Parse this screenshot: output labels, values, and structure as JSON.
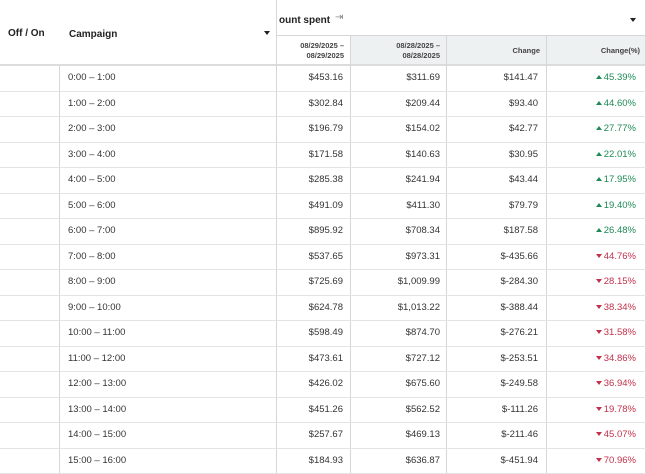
{
  "header": {
    "off_on": "Off / On",
    "campaign": "Campaign",
    "group_label": "ount spent",
    "resize_icon": "⇥",
    "date_range_1": [
      "08/29/2025 –",
      "08/29/2025"
    ],
    "date_range_2": [
      "08/28/2025 –",
      "08/28/2025"
    ],
    "change": "Change",
    "change_pct": "Change(%)"
  },
  "colors": {
    "positive": "#1f8a56",
    "negative": "#c2314a"
  },
  "rows": [
    {
      "campaign": "0:00 – 1:00",
      "d1": "$453.16",
      "d2": "$311.69",
      "change": "$141.47",
      "pct": "45.39%",
      "dir": "up"
    },
    {
      "campaign": "1:00 – 2:00",
      "d1": "$302.84",
      "d2": "$209.44",
      "change": "$93.40",
      "pct": "44.60%",
      "dir": "up"
    },
    {
      "campaign": "2:00 – 3:00",
      "d1": "$196.79",
      "d2": "$154.02",
      "change": "$42.77",
      "pct": "27.77%",
      "dir": "up"
    },
    {
      "campaign": "3:00 – 4:00",
      "d1": "$171.58",
      "d2": "$140.63",
      "change": "$30.95",
      "pct": "22.01%",
      "dir": "up"
    },
    {
      "campaign": "4:00 – 5:00",
      "d1": "$285.38",
      "d2": "$241.94",
      "change": "$43.44",
      "pct": "17.95%",
      "dir": "up"
    },
    {
      "campaign": "5:00 – 6:00",
      "d1": "$491.09",
      "d2": "$411.30",
      "change": "$79.79",
      "pct": "19.40%",
      "dir": "up"
    },
    {
      "campaign": "6:00 – 7:00",
      "d1": "$895.92",
      "d2": "$708.34",
      "change": "$187.58",
      "pct": "26.48%",
      "dir": "up"
    },
    {
      "campaign": "7:00 – 8:00",
      "d1": "$537.65",
      "d2": "$973.31",
      "change": "$-435.66",
      "pct": "44.76%",
      "dir": "down"
    },
    {
      "campaign": "8:00 – 9:00",
      "d1": "$725.69",
      "d2": "$1,009.99",
      "change": "$-284.30",
      "pct": "28.15%",
      "dir": "down"
    },
    {
      "campaign": "9:00 – 10:00",
      "d1": "$624.78",
      "d2": "$1,013.22",
      "change": "$-388.44",
      "pct": "38.34%",
      "dir": "down"
    },
    {
      "campaign": "10:00 – 11:00",
      "d1": "$598.49",
      "d2": "$874.70",
      "change": "$-276.21",
      "pct": "31.58%",
      "dir": "down"
    },
    {
      "campaign": "11:00 – 12:00",
      "d1": "$473.61",
      "d2": "$727.12",
      "change": "$-253.51",
      "pct": "34.86%",
      "dir": "down"
    },
    {
      "campaign": "12:00 – 13:00",
      "d1": "$426.02",
      "d2": "$675.60",
      "change": "$-249.58",
      "pct": "36.94%",
      "dir": "down"
    },
    {
      "campaign": "13:00 – 14:00",
      "d1": "$451.26",
      "d2": "$562.52",
      "change": "$-111.26",
      "pct": "19.78%",
      "dir": "down"
    },
    {
      "campaign": "14:00 – 15:00",
      "d1": "$257.67",
      "d2": "$469.13",
      "change": "$-211.46",
      "pct": "45.07%",
      "dir": "down"
    },
    {
      "campaign": "15:00 – 16:00",
      "d1": "$184.93",
      "d2": "$636.87",
      "change": "$-451.94",
      "pct": "70.96%",
      "dir": "down"
    }
  ]
}
